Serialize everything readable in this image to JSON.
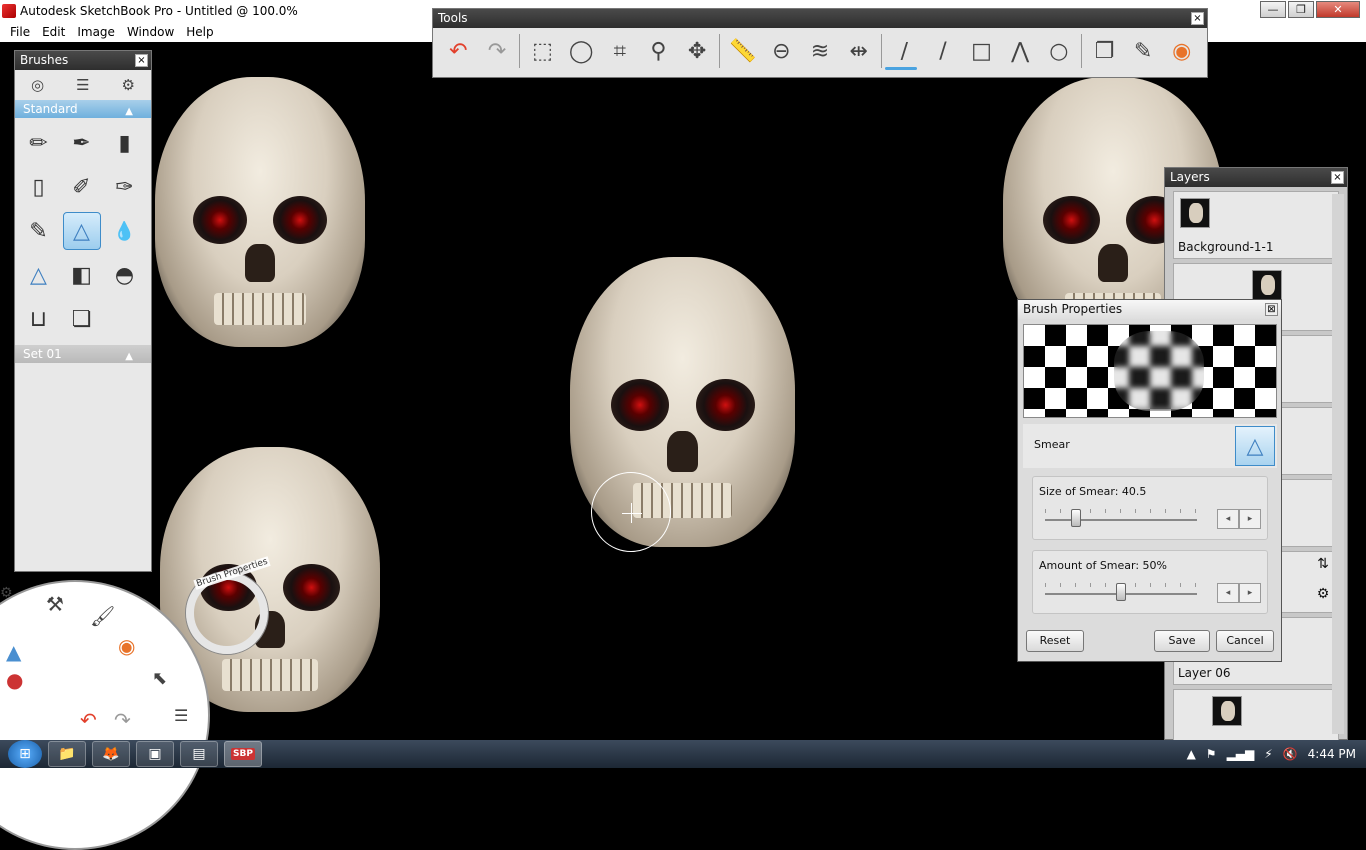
{
  "window": {
    "title": "Autodesk SketchBook Pro - Untitled @ 100.0%",
    "controls": [
      "—",
      "❐",
      "✕"
    ]
  },
  "menu": [
    "File",
    "Edit",
    "Image",
    "Window",
    "Help"
  ],
  "tools_panel": {
    "title": "Tools",
    "close": "×",
    "tools": [
      {
        "icon": "undo-icon",
        "glyph": "↶"
      },
      {
        "icon": "redo-icon",
        "glyph": "↷"
      },
      {
        "icon": "rect-select-icon",
        "glyph": "⬚"
      },
      {
        "icon": "lasso-icon",
        "glyph": "◯"
      },
      {
        "icon": "crop-icon",
        "glyph": "⌗"
      },
      {
        "icon": "zoom-icon",
        "glyph": "⚲"
      },
      {
        "icon": "move-icon",
        "glyph": "✥"
      },
      {
        "icon": "ruler-icon",
        "glyph": "📏"
      },
      {
        "icon": "ellipse-guide-icon",
        "glyph": "⊖"
      },
      {
        "icon": "french-curve-icon",
        "glyph": "≋"
      },
      {
        "icon": "symmetry-icon",
        "glyph": "⇹"
      },
      {
        "icon": "curve-icon",
        "glyph": "∕"
      },
      {
        "icon": "line-icon",
        "glyph": "/"
      },
      {
        "icon": "rectangle-icon",
        "glyph": "□"
      },
      {
        "icon": "polyline-icon",
        "glyph": "⋀"
      },
      {
        "icon": "circle-icon",
        "glyph": "○"
      },
      {
        "icon": "copy-icon",
        "glyph": "❐"
      },
      {
        "icon": "brushes-icon",
        "glyph": "✎"
      },
      {
        "icon": "color-wheel-icon",
        "glyph": "◉"
      }
    ]
  },
  "brushes_panel": {
    "title": "Brushes",
    "close": "×",
    "set1": "Standard",
    "set2": "Set 01",
    "brushes": [
      {
        "icon": "pencil-icon",
        "glyph": "✏",
        "selected": false
      },
      {
        "icon": "technical-pen-icon",
        "glyph": "✒",
        "selected": false
      },
      {
        "icon": "marker-icon",
        "glyph": "▮",
        "selected": false
      },
      {
        "icon": "felt-pen-icon",
        "glyph": "▯",
        "selected": false
      },
      {
        "icon": "ballpoint-icon",
        "glyph": "✐",
        "selected": false
      },
      {
        "icon": "paintbrush-icon",
        "glyph": "✑",
        "selected": false
      },
      {
        "icon": "ink-pen-icon",
        "glyph": "✎",
        "selected": false
      },
      {
        "icon": "smear-icon",
        "glyph": "△",
        "selected": true
      },
      {
        "icon": "water-drop-icon",
        "glyph": "💧",
        "selected": false
      },
      {
        "icon": "sharpen-icon",
        "glyph": "△",
        "selected": false
      },
      {
        "icon": "eraser-hard-icon",
        "glyph": "◧",
        "selected": false
      },
      {
        "icon": "eraser-soft-icon",
        "glyph": "◓",
        "selected": false
      },
      {
        "icon": "paint-bucket-icon",
        "glyph": "⊔",
        "selected": false
      },
      {
        "icon": "copy-brush-icon",
        "glyph": "❏",
        "selected": false
      }
    ]
  },
  "layers_panel": {
    "title": "Layers",
    "close": "×",
    "layers": [
      "Background-1-1",
      "",
      "",
      "",
      "",
      "",
      "Layer 06",
      ""
    ]
  },
  "brush_properties": {
    "title": "Brush Properties",
    "close": "⊠",
    "brush_name": "Smear",
    "size_label": "Size of Smear: 40.5",
    "size_value": 40.5,
    "amount_label": "Amount of Smear: 50%",
    "amount_value": 50,
    "reset": "Reset",
    "save": "Save",
    "cancel": "Cancel"
  },
  "lagoon": {
    "puck_label": "Brush Properties"
  },
  "taskbar": {
    "apps": [
      "folder-icon",
      "firefox-icon",
      "media-icon",
      "notepad-icon",
      "sketchbook-icon"
    ],
    "app_glyphs": [
      "📁",
      "🦊",
      "▣",
      "▤",
      "S"
    ],
    "app_badge": "SBP",
    "clock": "4:44 PM"
  }
}
